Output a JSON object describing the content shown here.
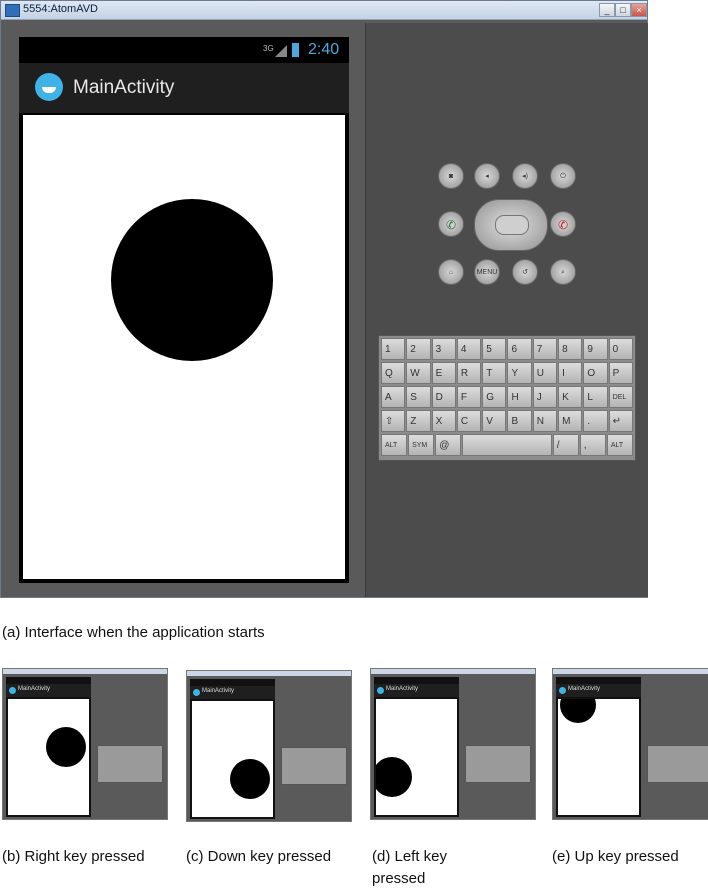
{
  "window": {
    "title": "5554:AtomAVD",
    "min_label": "_",
    "max_label": "□",
    "close_label": "×"
  },
  "status_bar": {
    "network": "3G",
    "time": "2:40"
  },
  "app": {
    "title": "MainActivity"
  },
  "hardware_keys": {
    "menu_label": "MENU"
  },
  "keyboard": {
    "row1": [
      "1",
      "2",
      "3",
      "4",
      "5",
      "6",
      "7",
      "8",
      "9",
      "0"
    ],
    "row2": [
      "Q",
      "W",
      "E",
      "R",
      "T",
      "Y",
      "U",
      "I",
      "O",
      "P"
    ],
    "row3": [
      "A",
      "S",
      "D",
      "F",
      "G",
      "H",
      "J",
      "K",
      "L",
      "DEL"
    ],
    "row4": [
      "⇧",
      "Z",
      "X",
      "C",
      "V",
      "B",
      "N",
      "M",
      ".",
      "↵"
    ],
    "row5": [
      "ALT",
      "SYM",
      "@",
      "",
      "",
      "/",
      "?",
      ",",
      "ALT"
    ]
  },
  "captions": {
    "a": "(a) Interface when the application starts",
    "b": "(b) Right key pressed",
    "c": "(c) Down key pressed",
    "d": "(d) Left key pressed",
    "e": "(e) Up key pressed"
  },
  "mini_title": "MainActivity",
  "colors": {
    "accent": "#4da8e0",
    "phone_bg": "#000000",
    "content_bg": "#ffffff",
    "emulator_bg": "#5a5a5a"
  }
}
